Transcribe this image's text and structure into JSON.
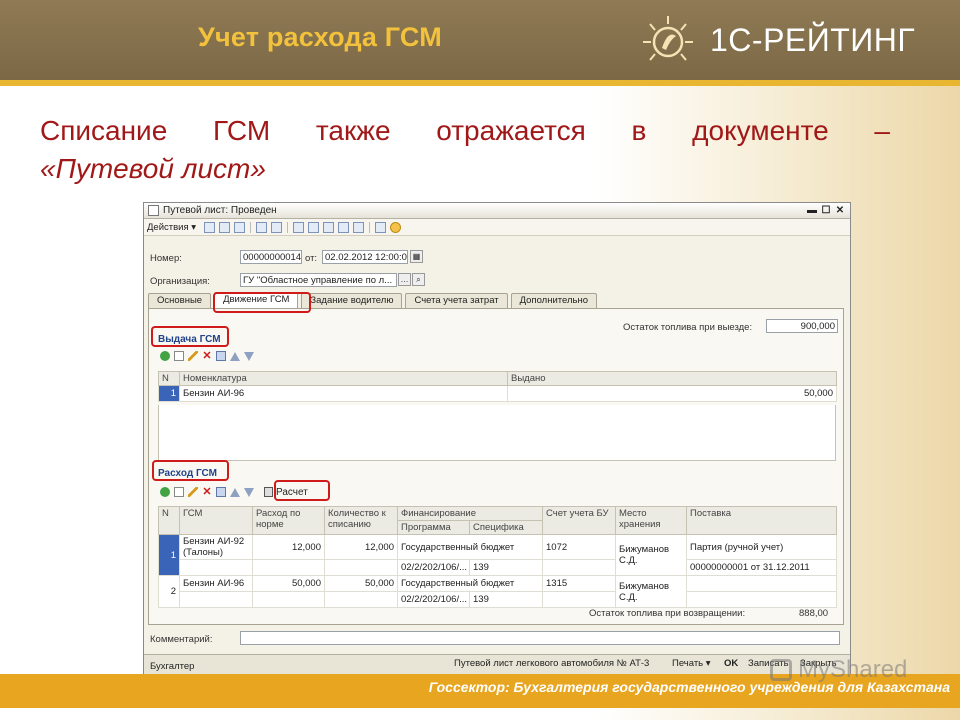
{
  "slide": {
    "title": "Учет расхода ГСМ",
    "brand": "1С-РЕЙТИНГ",
    "heading_words": [
      "Списание",
      "ГСМ",
      "также",
      "отражается",
      "в",
      "документе",
      "–"
    ],
    "heading_line2": "«Путевой лист»",
    "footer": "Госсектор: Бухгалтерия государственного учреждения для Казахстана",
    "watermark": "MyShared"
  },
  "window": {
    "title": "Путевой лист: Проведен",
    "toolbar_actions": "Действия",
    "number_label": "Номер:",
    "number_value": "00000000014",
    "date_label": "от:",
    "date_value": "02.02.2012 12:00:01",
    "org_label": "Организация:",
    "org_value": "ГУ \"Областное управление по л...",
    "tabs": [
      "Основные",
      "Движение ГСМ",
      "Задание водителю",
      "Счета учета затрат",
      "Дополнительно"
    ],
    "fuel_out_label": "Остаток топлива при выезде:",
    "fuel_out_value": "900,000",
    "issue": {
      "title": "Выдача ГСМ",
      "columns": [
        "N",
        "Номенклатура",
        "Выдано"
      ],
      "rows": [
        {
          "n": "1",
          "item": "Бензин АИ-96",
          "issued": "50,000"
        }
      ]
    },
    "consumption": {
      "title": "Расход ГСМ",
      "calc_button": "Расчет",
      "columns": {
        "n": "N",
        "fuel": "ГСМ",
        "norm": "Расход по норме",
        "qty": "Количество к списанию",
        "financing": "Финансирование",
        "program": "Программа",
        "specific": "Специфика",
        "account": "Счет учета БУ",
        "place": "Место хранения",
        "supply": "Поставка"
      },
      "rows": [
        {
          "n": "1",
          "fuel": "Бензин АИ-92 (Талоны)",
          "norm": "12,000",
          "qty": "12,000",
          "financing": "Государственный бюджет",
          "program": "02/2/202/106/...",
          "specific": "139",
          "account": "1072",
          "place": "Бижуманов С.Д.",
          "supply1": "Партия (ручной учет)",
          "supply2": "00000000001 от 31.12.2011"
        },
        {
          "n": "2",
          "fuel": "Бензин АИ-96",
          "norm": "50,000",
          "qty": "50,000",
          "financing": "Государственный бюджет",
          "program": "02/2/202/106/...",
          "specific": "139",
          "account": "1315",
          "place": "Бижуманов С.Д.",
          "supply1": "",
          "supply2": ""
        }
      ]
    },
    "fuel_back_label": "Остаток топлива при возвращении:",
    "fuel_back_value": "888,00",
    "comment_label": "Комментарий:",
    "status": {
      "left": "Бухгалтер",
      "doc": "Путевой лист легкового автомобиля № АТ-3",
      "print": "Печать",
      "ok": "OK",
      "record": "Записать",
      "close": "Закрыть"
    }
  }
}
